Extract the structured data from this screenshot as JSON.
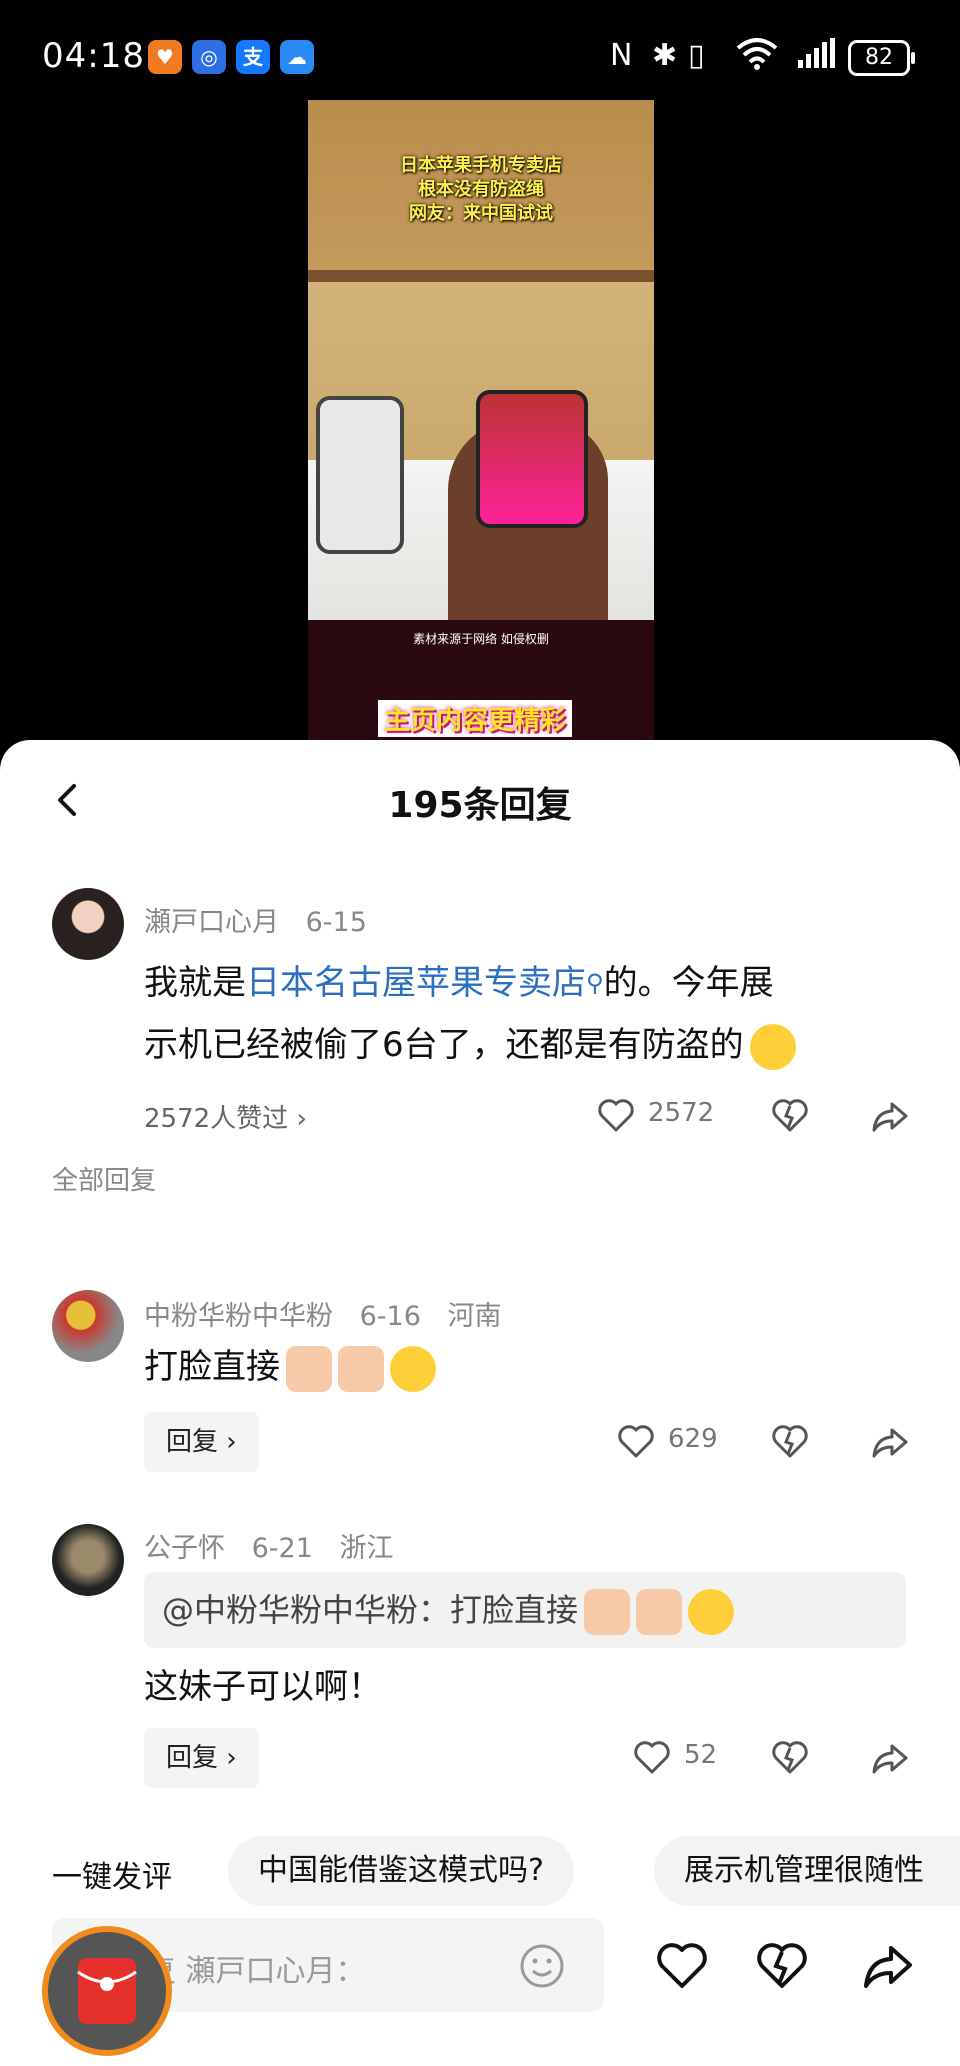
{
  "status_bar": {
    "time": "04:18",
    "battery": "82"
  },
  "video": {
    "caption_lines": [
      "日本苹果手机专卖店",
      "根本没有防盗绳",
      "网友：来中国试试"
    ],
    "source_note": "素材来源于网络 如侵权删",
    "banner": "主页内容更精彩"
  },
  "sheet": {
    "title": "195条回复",
    "back_icon": "chevron-left-icon"
  },
  "main_comment": {
    "author": "瀬戸口心月",
    "date": "6-15",
    "text_before_link": "我就是",
    "link_text": "日本名古屋苹果专卖店",
    "text_after_link": "的。今年展",
    "text_line2": "示机已经被偷了6台了，还都是有防盗的",
    "liked_by": "2572人赞过",
    "like_count": "2572"
  },
  "section_label": "全部回复",
  "replies": [
    {
      "author": "中粉华粉中华粉",
      "date": "6-16",
      "location": "河南",
      "text": "打脸直接",
      "reply_label": "回复",
      "like_count": "629"
    },
    {
      "author": "公子怀",
      "date": "6-21",
      "location": "浙江",
      "quote": "@中粉华粉中华粉：打脸直接",
      "text": "这妹子可以啊！",
      "reply_label": "回复",
      "like_count": "52"
    }
  ],
  "quick_comment": {
    "label": "一键发评",
    "chips": [
      "中国能借鉴这模式吗?",
      "展示机管理很随性"
    ]
  },
  "input": {
    "placeholder": "回复 瀬戸口心月："
  },
  "colors": {
    "link": "#2b6fc0",
    "accent_orange": "#f18b1c",
    "redpacket": "#e5302c"
  }
}
